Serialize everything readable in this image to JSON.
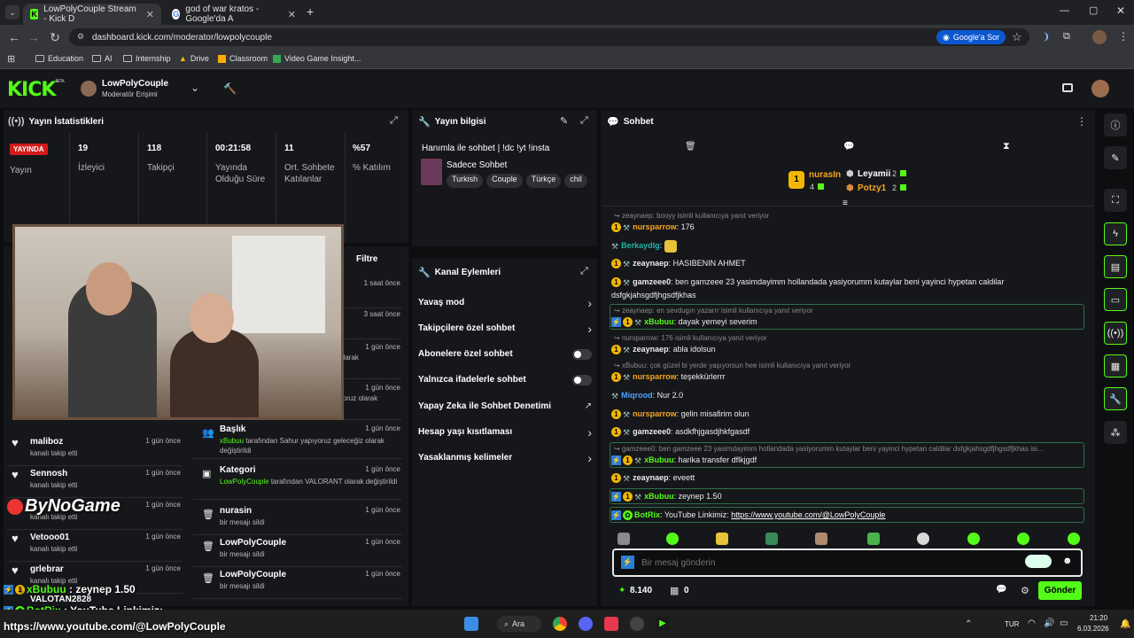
{
  "browser": {
    "tabs": [
      {
        "title": "LowPolyCouple Stream - Kick D",
        "icon": "kick-favicon"
      },
      {
        "title": "god of war kratos - Google'da A",
        "icon": "google-favicon"
      }
    ],
    "url": "dashboard.kick.com/moderator/lowpolycouple",
    "google_btn": "Google'a Sor",
    "bookmarks": [
      "Education",
      "AI",
      "Internship",
      "Drive",
      "Classroom",
      "Video Game Insight..."
    ]
  },
  "header": {
    "logo": "KICK",
    "beta": "BETA",
    "channel": "LowPolyCouple",
    "role": "Moderatör Erişimi"
  },
  "stats": {
    "title": "Yayın İstatistikleri",
    "live_badge": "YAYINDA",
    "live_label": "Yayın",
    "items": [
      {
        "value": "19",
        "label": "İzleyici"
      },
      {
        "value": "118",
        "label": "Takipçi"
      },
      {
        "value": "00:21:58",
        "label": "Yayında Olduğu Süre"
      },
      {
        "value": "11",
        "label": "Ort. Sohbete Katılanlar"
      },
      {
        "value": "%57",
        "label": "% Katılım"
      }
    ]
  },
  "activity": {
    "filter": "Filtre",
    "items": [
      {
        "time": "1 saat önce"
      },
      {
        "time": "3 saat önce"
      },
      {
        "time": "1 gün önce",
        "desc": "ting olarak"
      },
      {
        "time": "1 gün önce",
        "desc": "kasıyoruz olarak"
      },
      {
        "name": "Başlık",
        "user": "xBubuu",
        "desc": "tarafından Sahur yapıyoruz geleceğiz olarak değiştirildi",
        "time": "1 gün önce"
      },
      {
        "name": "Kategori",
        "user": "LowPolyCouple",
        "desc": "tarafından VALORANT olarak değiştirildi",
        "time": "1 gün önce"
      },
      {
        "name": "nurasin",
        "desc": "bir mesajı sildi",
        "time": "1 gün önce"
      },
      {
        "name": "LowPolyCouple",
        "desc": "bir mesajı sildi",
        "time": "1 gün önce"
      },
      {
        "name": "LowPolyCouple",
        "desc": "bir mesajı sildi",
        "time": "1 gün önce"
      }
    ]
  },
  "followers": {
    "items": [
      {
        "name": "maliboz",
        "desc": "kanalı takip etti",
        "time": "1 gün önce"
      },
      {
        "name": "Sennosh",
        "desc": "kanalı takip etti",
        "time": "1 gün önce"
      },
      {
        "name": "",
        "desc": "kanalı takip etti",
        "time": "1 gün önce"
      },
      {
        "name": "Vetooo01",
        "desc": "kanalı takip etti",
        "time": "1 gün önce"
      },
      {
        "name": "grlebrar",
        "desc": "kanalı takip etti",
        "time": "1 gün önce"
      },
      {
        "name": "VALOTAN2828",
        "desc": "",
        "time": ""
      }
    ]
  },
  "stream_info": {
    "title": "Yayın bilgisi",
    "stream_title": "Hanımla ile sohbet | !dc !yt !insta",
    "category": "Sadece Sohbet",
    "tags": [
      "Turkish",
      "Couple",
      "Türkçe",
      "chil"
    ]
  },
  "channel_actions": {
    "title": "Kanal Eylemleri",
    "items": [
      {
        "label": "Yavaş mod",
        "type": "chevron"
      },
      {
        "label": "Takipçilere özel sohbet",
        "type": "chevron"
      },
      {
        "label": "Abonelere özel sohbet",
        "type": "toggle"
      },
      {
        "label": "Yalnızca ifadelerle sohbet",
        "type": "toggle"
      },
      {
        "label": "Yapay Zeka ile Sohbet Denetimi",
        "type": "external"
      },
      {
        "label": "Hesap yaşı kısıtlaması",
        "type": "chevron"
      },
      {
        "label": "Yasaklanmış kelimeler",
        "type": "chevron"
      }
    ]
  },
  "chat": {
    "title": "Sohbet",
    "leaderboard": {
      "top": {
        "rank": "1",
        "name": "nurasIn",
        "count": "4"
      },
      "second": {
        "name": "Leyamii",
        "count": "2"
      },
      "third": {
        "name": "Potzy1",
        "count": "2"
      }
    },
    "messages": [
      {
        "reply": "zeaynaep: booyy isimli kullanıcıya yanıt veriyor"
      },
      {
        "user": "nursparrow",
        "color": "#f5a623",
        "text": "176",
        "badges": [
          "1",
          "mod"
        ]
      },
      {
        "user": "Berkaydlg",
        "color": "#1db4a8",
        "text": "",
        "badges": [
          "mod"
        ]
      },
      {
        "user": "zeaynaep",
        "color": "#ffffff",
        "text": "HASIBENIN AHMET",
        "badges": [
          "1",
          "mod"
        ]
      },
      {
        "user": "gamzeee0",
        "color": "#ffffff",
        "text": "ben gamzeee 23 yasimdayimm hollandada yasiyorumm kutaylar beni yayinci hypetan caldilar dsfgkjahsgdfjhgsdfjkhas",
        "badges": [
          "1",
          "mod"
        ]
      },
      {
        "reply": "zeaynaep: en sevdugın yazarrr isimli kullanıcıya yanıt veriyor"
      },
      {
        "user": "xBubuu",
        "color": "#53fc18",
        "text": "dayak yemeyi severim",
        "badges": [
          "kick",
          "1",
          "mod"
        ]
      },
      {
        "reply": "nursparrow: 176 isimli kullanıcıya yanıt veriyor"
      },
      {
        "user": "zeaynaep",
        "color": "#ffffff",
        "text": "abla idolsun",
        "badges": [
          "1",
          "mod"
        ]
      },
      {
        "reply": "xBubuu: çok güzel bi yerde yaşıyorsun hee isimli kullanıcıya yanıt veriyor"
      },
      {
        "user": "nursparrow",
        "color": "#f5a623",
        "text": "teşekkürlerrr",
        "badges": [
          "1",
          "mod"
        ]
      },
      {
        "user": "Miqrood",
        "color": "#4aa3ff",
        "text": "Nur 2.0",
        "badges": [
          "mod"
        ]
      },
      {
        "user": "nursparrow",
        "color": "#f5a623",
        "text": "gelin misafirim olun",
        "badges": [
          "1",
          "mod"
        ]
      },
      {
        "user": "gamzeee0",
        "color": "#ffffff",
        "text": "asdkfhjgasdjhkfgasdf",
        "badges": [
          "1",
          "mod"
        ]
      },
      {
        "reply": "gamzeee0: ben gamzeee 23 yasimdayimm hollandada yasiyorumm kutaylar beni yayinci hypetan caldilar dsfgkjahsgdfjhgsdfjkhas isi..."
      },
      {
        "user": "xBubuu",
        "color": "#53fc18",
        "text": "harika transfer dflkjgdf",
        "badges": [
          "kick",
          "1",
          "mod"
        ]
      },
      {
        "user": "zeaynaep",
        "color": "#ffffff",
        "text": "eveett",
        "badges": [
          "1",
          "mod"
        ]
      },
      {
        "user": "xBubuu",
        "color": "#53fc18",
        "text": "zeynep 1.50",
        "badges": [
          "kick",
          "1",
          "mod"
        ]
      },
      {
        "user": "BotRix",
        "color": "#53fc18",
        "text": "YouTube Linkimiz: ",
        "link": "https://www.youtube.com/@LowPolyCouple",
        "badges": [
          "kick",
          "bot"
        ]
      }
    ],
    "input_placeholder": "Bir mesaj gönderin",
    "points": "8.140",
    "inventory": "0",
    "send": "Gönder"
  },
  "overlay": {
    "logo_text": "ByNoGame",
    "lines": [
      {
        "user": "xBubuu",
        "text": " : zeynep 1.50"
      },
      {
        "user": "BotRix",
        "text": " : YouTube Linkimiz:"
      }
    ],
    "url": "https://www.youtube.com/@LowPolyCouple"
  },
  "taskbar": {
    "search": "Ara",
    "lang": "TUR",
    "time": "21:20",
    "date": "6.03.2026"
  },
  "colors": {
    "accent": "#53fc18",
    "bg": "#0d0e10",
    "panel": "#16171a"
  }
}
